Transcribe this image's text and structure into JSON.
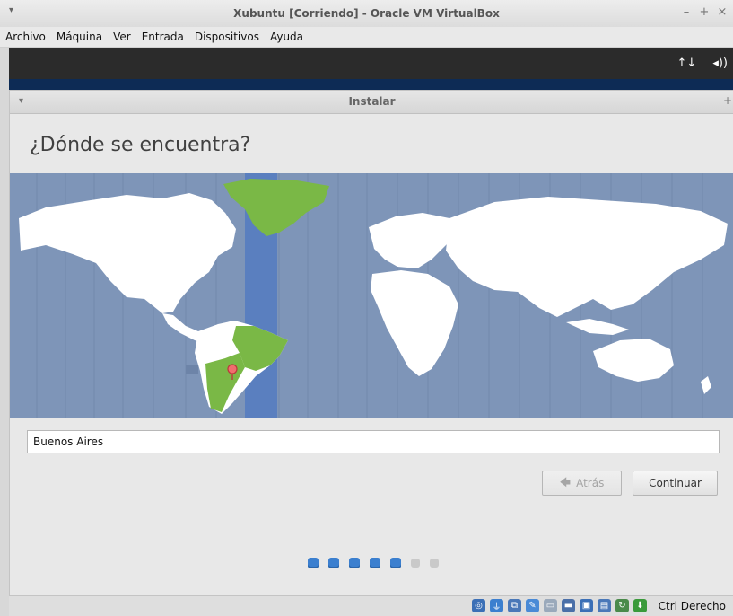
{
  "window": {
    "title": "Xubuntu [Corriendo] - Oracle VM VirtualBox",
    "controls": [
      "–",
      "+",
      "×"
    ]
  },
  "menubar": [
    "Archivo",
    "Máquina",
    "Ver",
    "Entrada",
    "Dispositivos",
    "Ayuda"
  ],
  "guest_panel": {
    "network_icon": "↑↓",
    "volume_icon": "◂))"
  },
  "installer": {
    "title": "Instalar",
    "heading": "¿Dónde se encuentra?",
    "location_value": "Buenos Aires",
    "back_label": "Atrás",
    "continue_label": "Continuar",
    "progress": {
      "steps_total": 7,
      "steps_done": 5
    }
  },
  "status_bar": {
    "icons": [
      "optical-drive-icon",
      "usb-icon",
      "network-icon",
      "pen-icon",
      "shared-folder-icon",
      "display-icon",
      "video-capture-icon",
      "cpu-icon",
      "mouse-integration-icon",
      "keyboard-icon"
    ],
    "host_key": "Ctrl Derecho"
  },
  "colors": {
    "ocean": "#7e95b8",
    "selected_zone": "#5a7fbf",
    "land": "#ffffff",
    "highlight_land": "#7ab846",
    "progress_on": "#3b7fcf",
    "progress_off": "#c9c9c9"
  }
}
